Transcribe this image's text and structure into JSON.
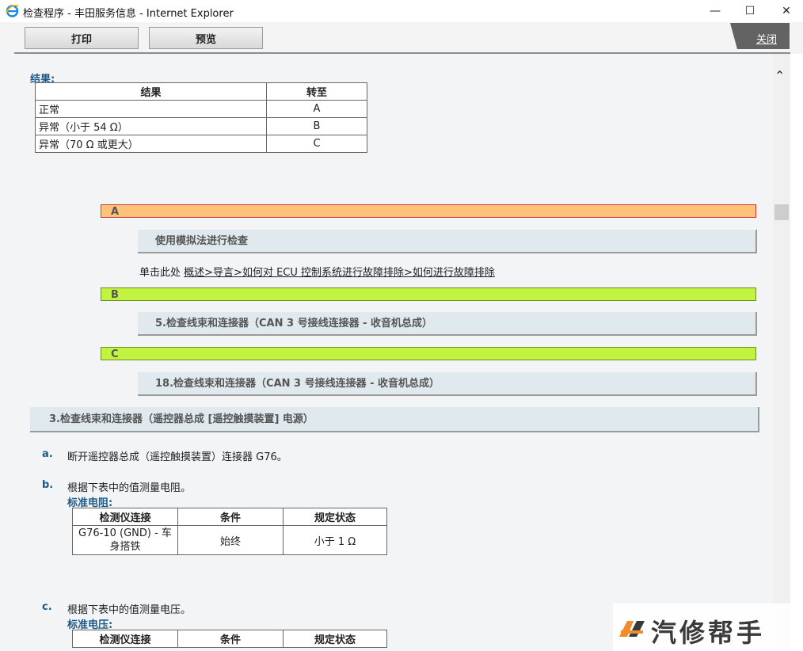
{
  "window": {
    "title": "检查程序 - 丰田服务信息 - Internet Explorer",
    "minimize": "—",
    "maximize": "☐",
    "close": "✕"
  },
  "toolbar": {
    "print_label": "打印",
    "preview_label": "预览",
    "close_label": "关闭"
  },
  "results": {
    "label": "结果:",
    "headers": [
      "结果",
      "转至"
    ],
    "rows": [
      [
        "正常",
        "A"
      ],
      [
        "异常（小于 54 Ω）",
        "B"
      ],
      [
        "异常（70 Ω 或更大）",
        "C"
      ]
    ]
  },
  "branch_a": {
    "bar": "A",
    "step": "使用模拟法进行检查",
    "link_prefix": "单击此处",
    "link_text": "概述>导言>如何对 ECU 控制系统进行故障排除>如何进行故障排除"
  },
  "branch_b": {
    "bar": "B",
    "step": "5.检查线束和连接器（CAN 3 号接线连接器 - 收音机总成）"
  },
  "branch_c": {
    "bar": "C",
    "step": "18.检查线束和连接器（CAN 3 号接线连接器 - 收音机总成）"
  },
  "step3": {
    "title": "3.检查线束和连接器（遥控器总成 [遥控触摸装置] 电源）",
    "item_a": {
      "letter": "a.",
      "text": "断开遥控器总成（遥控触摸装置）连接器 G76。"
    },
    "item_b": {
      "letter": "b.",
      "text": "根据下表中的值测量电阻。",
      "label": "标准电阻:"
    },
    "resistance_table": {
      "headers": [
        "检测仪连接",
        "条件",
        "规定状态"
      ],
      "rows": [
        [
          "G76-10 (GND) - 车身搭铁",
          "始终",
          "小于 1 Ω"
        ]
      ]
    },
    "item_c": {
      "letter": "c.",
      "text": "根据下表中的值测量电压。",
      "label": "标准电压:"
    },
    "voltage_table": {
      "headers": [
        "检测仪连接",
        "条件",
        "规定状态"
      ]
    }
  },
  "watermark": {
    "text": "汽修帮手"
  }
}
